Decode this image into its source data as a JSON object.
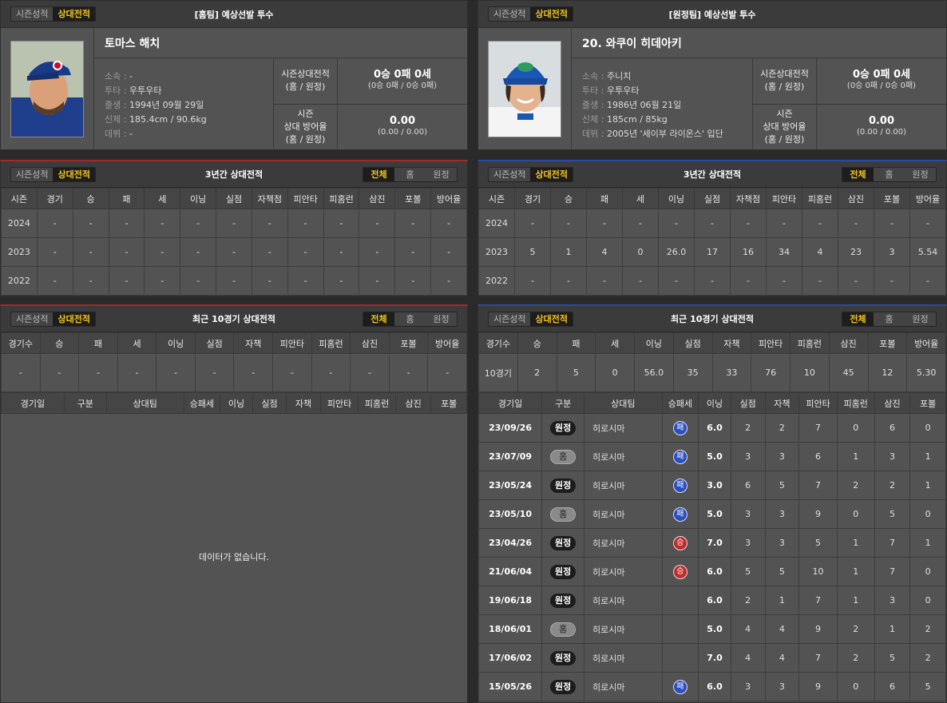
{
  "tabs": {
    "season": "시즌성적",
    "vs": "상대전적"
  },
  "filters": {
    "all": "전체",
    "home": "홈",
    "away": "원정"
  },
  "home": {
    "panel_title": "[홈팀] 예상선발 투수",
    "name": "토마스 해치",
    "facts": [
      {
        "k": "소속",
        "v": "-"
      },
      {
        "k": "투타",
        "v": "우투우타"
      },
      {
        "k": "출생",
        "v": "1994년 09월 29일"
      },
      {
        "k": "신체",
        "v": "185.4cm / 90.6kg"
      },
      {
        "k": "데뷔",
        "v": "-"
      }
    ],
    "record_label_1": "시즌상대전적",
    "record_label_1b": "(홈 / 원정)",
    "record_value_1": "0승 0패 0세",
    "record_sub_1": "(0승 0패 / 0승 0패)",
    "record_label_2a": "시즌",
    "record_label_2b": "상대 방어율",
    "record_label_2c": "(홈 / 원정)",
    "record_value_2": "0.00",
    "record_sub_2": "(0.00 / 0.00)",
    "three_year_title": "3년간 상대전적",
    "three_year_rows": [
      {
        "season": "2024",
        "cells": [
          "-",
          "-",
          "-",
          "-",
          "-",
          "-",
          "-",
          "-",
          "-",
          "-",
          "-",
          "-"
        ]
      },
      {
        "season": "2023",
        "cells": [
          "-",
          "-",
          "-",
          "-",
          "-",
          "-",
          "-",
          "-",
          "-",
          "-",
          "-",
          "-"
        ]
      },
      {
        "season": "2022",
        "cells": [
          "-",
          "-",
          "-",
          "-",
          "-",
          "-",
          "-",
          "-",
          "-",
          "-",
          "-",
          "-"
        ]
      }
    ],
    "recent_title": "최근 10경기 상대전적",
    "recent_summary": [
      "-",
      "-",
      "-",
      "-",
      "-",
      "-",
      "-",
      "-",
      "-",
      "-",
      "-",
      "-"
    ],
    "no_data": "데이터가 없습니다."
  },
  "away": {
    "panel_title": "[원정팀] 예상선발 투수",
    "name": "20. 와쿠이 히데아키",
    "facts": [
      {
        "k": "소속",
        "v": "주니치"
      },
      {
        "k": "투타",
        "v": "우투우타"
      },
      {
        "k": "출생",
        "v": "1986년 06월 21일"
      },
      {
        "k": "신체",
        "v": "185cm / 85kg"
      },
      {
        "k": "데뷔",
        "v": "2005년 '세이부 라이온스' 입단"
      }
    ],
    "record_label_1": "시즌상대전적",
    "record_label_1b": "(홈 / 원정)",
    "record_value_1": "0승 0패 0세",
    "record_sub_1": "(0승 0패 / 0승 0패)",
    "record_label_2a": "시즌",
    "record_label_2b": "상대 방어율",
    "record_label_2c": "(홈 / 원정)",
    "record_value_2": "0.00",
    "record_sub_2": "(0.00 / 0.00)",
    "three_year_title": "3년간 상대전적",
    "three_year_rows": [
      {
        "season": "2024",
        "cells": [
          "-",
          "-",
          "-",
          "-",
          "-",
          "-",
          "-",
          "-",
          "-",
          "-",
          "-",
          "-"
        ]
      },
      {
        "season": "2023",
        "cells": [
          "5",
          "1",
          "4",
          "0",
          "26.0",
          "17",
          "16",
          "34",
          "4",
          "23",
          "3",
          "5.54"
        ]
      },
      {
        "season": "2022",
        "cells": [
          "-",
          "-",
          "-",
          "-",
          "-",
          "-",
          "-",
          "-",
          "-",
          "-",
          "-",
          "-"
        ]
      }
    ],
    "recent_title": "최근 10경기 상대전적",
    "recent_summary": [
      "10경기",
      "2",
      "5",
      "0",
      "56.0",
      "35",
      "33",
      "76",
      "10",
      "45",
      "12",
      "5.30"
    ],
    "games": [
      {
        "date": "23/09/26",
        "type": "원정",
        "kind": "away",
        "opp": "히로시마",
        "res": "패",
        "rk": "L",
        "ip": "6.0",
        "r": "2",
        "er": "2",
        "h": "7",
        "hr": "0",
        "so": "6",
        "bb": "0"
      },
      {
        "date": "23/07/09",
        "type": "홈",
        "kind": "home",
        "opp": "히로시마",
        "res": "패",
        "rk": "L",
        "ip": "5.0",
        "r": "3",
        "er": "3",
        "h": "6",
        "hr": "1",
        "so": "3",
        "bb": "1"
      },
      {
        "date": "23/05/24",
        "type": "원정",
        "kind": "away",
        "opp": "히로시마",
        "res": "패",
        "rk": "L",
        "ip": "3.0",
        "r": "6",
        "er": "5",
        "h": "7",
        "hr": "2",
        "so": "2",
        "bb": "1"
      },
      {
        "date": "23/05/10",
        "type": "홈",
        "kind": "home",
        "opp": "히로시마",
        "res": "패",
        "rk": "L",
        "ip": "5.0",
        "r": "3",
        "er": "3",
        "h": "9",
        "hr": "0",
        "so": "5",
        "bb": "0"
      },
      {
        "date": "23/04/26",
        "type": "원정",
        "kind": "away",
        "opp": "히로시마",
        "res": "승",
        "rk": "W",
        "ip": "7.0",
        "r": "3",
        "er": "3",
        "h": "5",
        "hr": "1",
        "so": "7",
        "bb": "1"
      },
      {
        "date": "21/06/04",
        "type": "원정",
        "kind": "away",
        "opp": "히로시마",
        "res": "승",
        "rk": "W",
        "ip": "6.0",
        "r": "5",
        "er": "5",
        "h": "10",
        "hr": "1",
        "so": "7",
        "bb": "0"
      },
      {
        "date": "19/06/18",
        "type": "원정",
        "kind": "away",
        "opp": "히로시마",
        "res": "",
        "rk": "",
        "ip": "6.0",
        "r": "2",
        "er": "1",
        "h": "7",
        "hr": "1",
        "so": "3",
        "bb": "0"
      },
      {
        "date": "18/06/01",
        "type": "홈",
        "kind": "home",
        "opp": "히로시마",
        "res": "",
        "rk": "",
        "ip": "5.0",
        "r": "4",
        "er": "4",
        "h": "9",
        "hr": "2",
        "so": "1",
        "bb": "2"
      },
      {
        "date": "17/06/02",
        "type": "원정",
        "kind": "away",
        "opp": "히로시마",
        "res": "",
        "rk": "",
        "ip": "7.0",
        "r": "4",
        "er": "4",
        "h": "7",
        "hr": "2",
        "so": "5",
        "bb": "2"
      },
      {
        "date": "15/05/26",
        "type": "원정",
        "kind": "away",
        "opp": "히로시마",
        "res": "패",
        "rk": "L",
        "ip": "6.0",
        "r": "3",
        "er": "3",
        "h": "9",
        "hr": "0",
        "so": "6",
        "bb": "5"
      }
    ]
  },
  "cols_three_year": [
    "시즌",
    "경기",
    "승",
    "패",
    "세",
    "이닝",
    "실점",
    "자책점",
    "피안타",
    "피홈런",
    "삼진",
    "포볼",
    "방어율"
  ],
  "cols_recent_summary": [
    "경기수",
    "승",
    "패",
    "세",
    "이닝",
    "실점",
    "자책",
    "피안타",
    "피홈런",
    "삼진",
    "포볼",
    "방어율"
  ],
  "cols_games": [
    "경기일",
    "구분",
    "상대팀",
    "승패세",
    "이닝",
    "실점",
    "자책",
    "피안타",
    "피홈런",
    "삼진",
    "포볼"
  ]
}
